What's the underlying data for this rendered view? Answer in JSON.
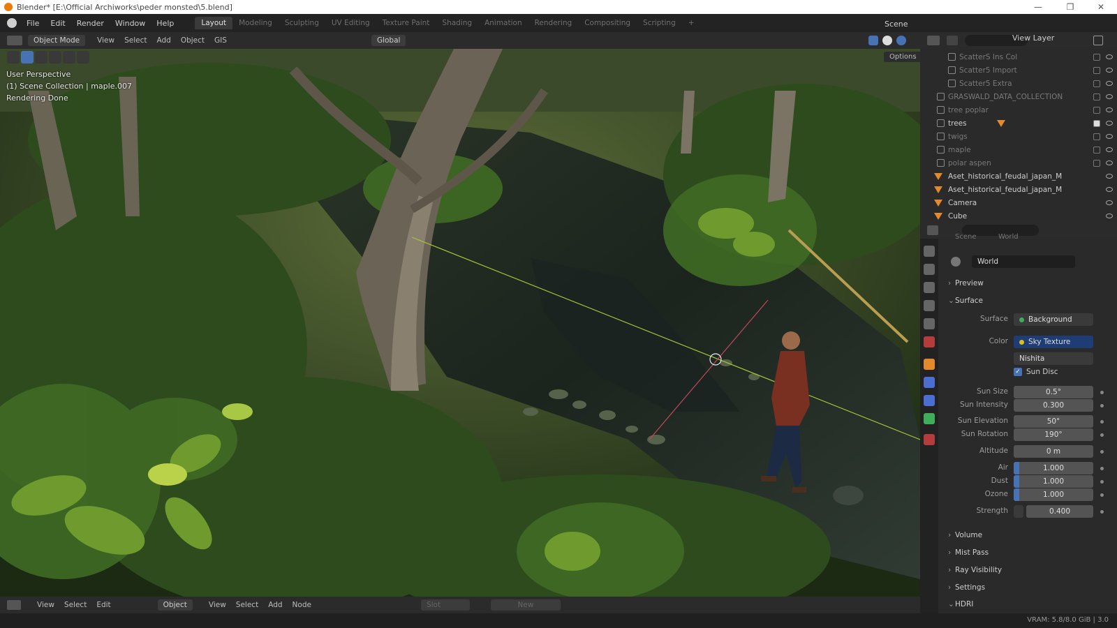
{
  "titlebar": {
    "title": "Blender* [E:\\Official Archiworks\\peder monsted\\5.blend]",
    "minimize": "—",
    "maximize": "❐",
    "close": "✕"
  },
  "menu": [
    "File",
    "Edit",
    "Render",
    "Window",
    "Help"
  ],
  "workspaces": [
    "Layout",
    "Modeling",
    "Sculpting",
    "UV Editing",
    "Texture Paint",
    "Shading",
    "Animation",
    "Rendering",
    "Compositing",
    "Scripting"
  ],
  "scene": "Scene",
  "view_layer": "View Layer",
  "viewport_header": {
    "mode": "Object Mode",
    "menus": [
      "View",
      "Select",
      "Add",
      "Object",
      "GIS"
    ],
    "orientation": "Global",
    "options": "Options"
  },
  "viewport_overlay": {
    "line1": "User Perspective",
    "line2": "(1) Scene Collection | maple.007",
    "line3": "Rendering Done"
  },
  "outliner": [
    {
      "name": "ScatterS Ins Col",
      "level": 3,
      "dim": true
    },
    {
      "name": "Scatter5 Import",
      "level": 3,
      "dim": true
    },
    {
      "name": "Scatter5 Extra",
      "level": 3,
      "dim": true
    },
    {
      "name": "GRASWALD_DATA_COLLECTION",
      "level": 2,
      "dim": true
    },
    {
      "name": "tree poplar",
      "level": 2,
      "dim": true
    },
    {
      "name": "trees",
      "level": 2,
      "dim": false
    },
    {
      "name": "twigs",
      "level": 2,
      "dim": true
    },
    {
      "name": "maple",
      "level": 2,
      "dim": true
    },
    {
      "name": "polar aspen",
      "level": 2,
      "dim": true
    },
    {
      "name": "Aset_historical_feudal_japan_M",
      "level": 2,
      "dim": false
    },
    {
      "name": "Aset_historical_feudal_japan_M",
      "level": 2,
      "dim": false
    },
    {
      "name": "Camera",
      "level": 2,
      "dim": false
    },
    {
      "name": "Cube",
      "level": 2,
      "dim": false
    }
  ],
  "properties": {
    "breadcrumb": [
      "Scene",
      "World"
    ],
    "world_name": "World",
    "sections": {
      "preview": "Preview",
      "surface": "Surface",
      "volume": "Volume",
      "mist_pass": "Mist Pass",
      "ray_visibility": "Ray Visibility",
      "settings": "Settings",
      "hdri": "HDRI"
    },
    "surface_label": "Surface",
    "surface_value": "Background",
    "color_label": "Color",
    "color_value": "Sky Texture",
    "sky_type": "Nishita",
    "sun_disc_label": "Sun Disc",
    "sun_disc_checked": true,
    "sun_size_label": "Sun Size",
    "sun_size": "0.5°",
    "sun_intensity_label": "Sun Intensity",
    "sun_intensity": "0.300",
    "sun_elevation_label": "Sun Elevation",
    "sun_elevation": "50°",
    "sun_rotation_label": "Sun Rotation",
    "sun_rotation": "190°",
    "altitude_label": "Altitude",
    "altitude": "0 m",
    "air_label": "Air",
    "air": "1.000",
    "dust_label": "Dust",
    "dust": "1.000",
    "ozone_label": "Ozone",
    "ozone": "1.000",
    "strength_label": "Strength",
    "strength": "0.400"
  },
  "bottom_header": {
    "menus": [
      "View",
      "Select",
      "Edit"
    ],
    "type": "Object",
    "menus2": [
      "View",
      "Select",
      "Add",
      "Node"
    ],
    "slot": "Slot",
    "new": "New"
  },
  "status": {
    "vram": "VRAM: 5.8/8.0 GiB | 3.0"
  },
  "colors": {
    "accent": "#4772b3",
    "orange": "#e38a2c",
    "selected": "#1f3d74"
  }
}
